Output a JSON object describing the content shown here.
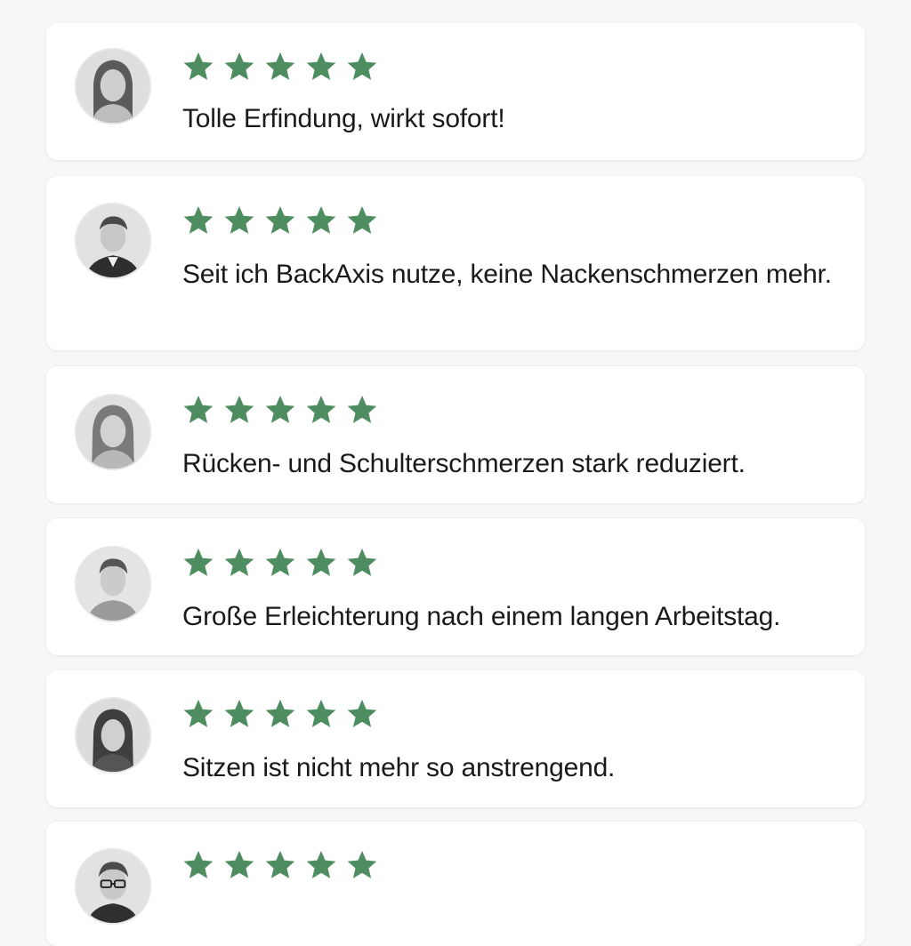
{
  "colors": {
    "star": "#4e8d5f",
    "card": "#ffffff",
    "background": "#f7f7f7",
    "text": "#1a1a1a"
  },
  "reviews": [
    {
      "rating": 5,
      "text": "Tolle Erfindung, wirkt sofort!",
      "avatar_icon": "woman-portrait-icon"
    },
    {
      "rating": 5,
      "text": "Seit ich BackAxis nutze, keine Nackenschmerzen mehr.",
      "avatar_icon": "man-suit-portrait-icon"
    },
    {
      "rating": 5,
      "text": "Rücken- und Schulterschmerzen stark reduziert.",
      "avatar_icon": "woman-portrait-icon"
    },
    {
      "rating": 5,
      "text": "Große Erleichterung nach einem langen Arbeitstag.",
      "avatar_icon": "man-portrait-icon"
    },
    {
      "rating": 5,
      "text": "Sitzen ist nicht mehr so anstrengend.",
      "avatar_icon": "woman-portrait-icon"
    },
    {
      "rating": 5,
      "text": "",
      "avatar_icon": "man-glasses-portrait-icon"
    }
  ]
}
